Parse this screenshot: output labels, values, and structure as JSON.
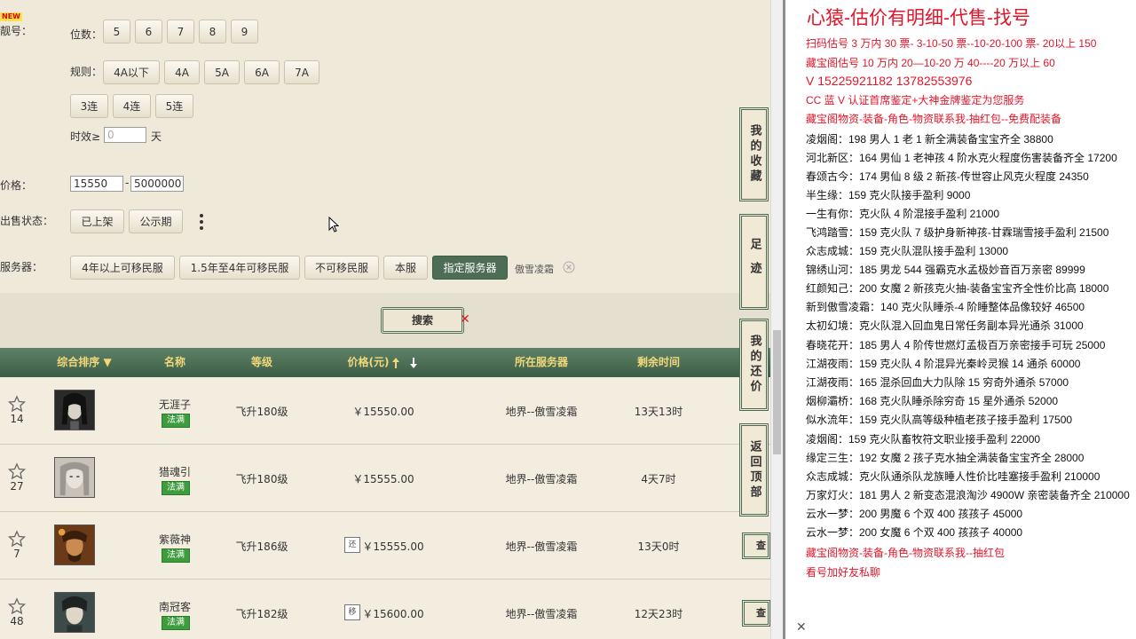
{
  "filter": {
    "new_badge": "NEW",
    "lianghao_label": "靓号：",
    "digits_label": "位数：",
    "digits": [
      "5",
      "6",
      "7",
      "8",
      "9"
    ],
    "rule_label": "规则：",
    "rules": [
      "4A以下",
      "4A",
      "5A",
      "6A",
      "7A"
    ],
    "lian": [
      "3连",
      "4连",
      "5连"
    ],
    "shixiao_label": "时效≥",
    "shixiao_placeholder": "0",
    "shixiao_unit": "天",
    "price_label": "价格：",
    "price_min": "15550",
    "price_sep": "-",
    "price_max": "5000000",
    "sale_label": "出售状态：",
    "sale_options": [
      "已上架",
      "公示期"
    ],
    "server_label": "服务器：",
    "server_options": [
      "4年以上可移民服",
      "1.5年至4年可移民服",
      "不可移民服",
      "本服",
      "指定服务器"
    ],
    "server_selected": "傲雪凌霜"
  },
  "search": {
    "label": "搜索",
    "clear": "✕"
  },
  "table": {
    "headers": {
      "rank": "综合排序 ▼",
      "name": "名称",
      "level": "等级",
      "price": "价格(元)",
      "server": "所在服务器",
      "time": "剩余时间"
    },
    "rows": [
      {
        "rank": "14",
        "name": "无涯子",
        "school": "法满",
        "level": "飞升180级",
        "tag": "",
        "price": "￥15550.00",
        "server": "地界--傲雪凌霜",
        "time": "13天13时"
      },
      {
        "rank": "27",
        "name": "猎魂引",
        "school": "法满",
        "level": "飞升180级",
        "tag": "",
        "price": "￥15555.00",
        "server": "地界--傲雪凌霜",
        "time": "4天7时"
      },
      {
        "rank": "7",
        "name": "紫薇神",
        "school": "法满",
        "level": "飞升186级",
        "tag": "还",
        "price": "￥15555.00",
        "server": "地界--傲雪凌霜",
        "time": "13天0时"
      },
      {
        "rank": "48",
        "name": "南冠客",
        "school": "法满",
        "level": "飞升182级",
        "tag": "移",
        "price": "￥15600.00",
        "server": "地界--傲雪凌霜",
        "time": "12天23时"
      }
    ],
    "view_button": "查"
  },
  "side_tabs": {
    "favorites": "我的收藏",
    "footprint": "足迹",
    "bargain": "我的还价",
    "back_top": "返回顶部"
  },
  "notes": {
    "title": "心猿-估价有明细-代售-找号",
    "lines": [
      {
        "text": "扫码估号 3 万内 30 票- 3-10-50 票--10-20-100 票- 20以上 150",
        "red": true
      },
      {
        "text": "藏宝阁估号 10 万内 20—10-20 万 40----20 万以上 60",
        "red": true
      },
      {
        "text": "V 15225921182   13782553976",
        "red": true,
        "mid": true
      },
      {
        "text": "CC 蓝 V 认证首席鉴定+大神金牌鉴定为您服务",
        "red": true
      },
      {
        "text": "藏宝阁物资-装备-角色-物资联系我-抽红包--免费配装备",
        "red": true
      },
      {
        "text": "凌烟阁：198 男人 1 老 1 新全满装备宝宝齐全 38800",
        "red": false
      },
      {
        "text": "河北新区：164 男仙 1 老神孩 4 阶水克火程度伤害装备齐全 17200",
        "red": false
      },
      {
        "text": "春颂古今：174 男仙 8 级 2 新孩-传世容止风克火程度 24350",
        "red": false
      },
      {
        "text": "半生缘：159 克火队接手盈利 9000",
        "red": false
      },
      {
        "text": "一生有你：克火队 4 阶混接手盈利 21000",
        "red": false
      },
      {
        "text": "飞鸿踏雪：159 克火队 7 级护身新神孩-甘霖瑞雪接手盈利 21500",
        "red": false
      },
      {
        "text": "众志成城：159 克火队混队接手盈利 13000",
        "red": false
      },
      {
        "text": "锦绣山河：185 男龙 544 强霸克水孟极妙音百万亲密 89999",
        "red": false
      },
      {
        "text": "红颜知己：200 女魔 2 新孩克火抽-装备宝宝齐全性价比高 18000",
        "red": false
      },
      {
        "text": "新到傲雪凌霜：140 克火队睡杀-4 阶睡整体品像较好 46500",
        "red": false
      },
      {
        "text": "太初幻境：克火队混入回血鬼日常任务副本异光通杀 31000",
        "red": false
      },
      {
        "text": "春晓花开：185 男人 4 阶传世燃灯孟极百万亲密接手可玩 25000",
        "red": false
      },
      {
        "text": "江湖夜雨：159 克火队 4 阶混异光秦岭灵猴 14 通杀 60000",
        "red": false
      },
      {
        "text": "江湖夜雨：165 混杀回血大力队除 15 穷奇外通杀 57000",
        "red": false
      },
      {
        "text": "烟柳灞桥：168 克火队睡杀除穷奇 15 星外通杀 52000",
        "red": false
      },
      {
        "text": "似水流年：159 克火队高等级种植老孩子接手盈利 17500",
        "red": false
      },
      {
        "text": "凌烟阁：159 克火队畜牧符文职业接手盈利 22000",
        "red": false
      },
      {
        "text": "缘定三生：192 女魔 2 孩子克水抽全满装备宝宝齐全 28000",
        "red": false
      },
      {
        "text": "众志成城：克火队通杀队龙族睡人性价比哇塞接手盈利 210000",
        "red": false
      },
      {
        "text": "万家灯火：181 男人 2 新变态混浪淘沙 4900W 亲密装备齐全 210000",
        "red": false
      },
      {
        "text": "云水一梦：200 男魔 6 个双 400 孩孩子 45000",
        "red": false
      },
      {
        "text": "云水一梦：200 女魔 6 个双 400 孩孩子 40000",
        "red": false
      },
      {
        "text": "藏宝阁物资-装备-角色-物资联系我--抽红包",
        "red": true
      },
      {
        "text": "看号加好友私聊",
        "red": true
      }
    ]
  }
}
